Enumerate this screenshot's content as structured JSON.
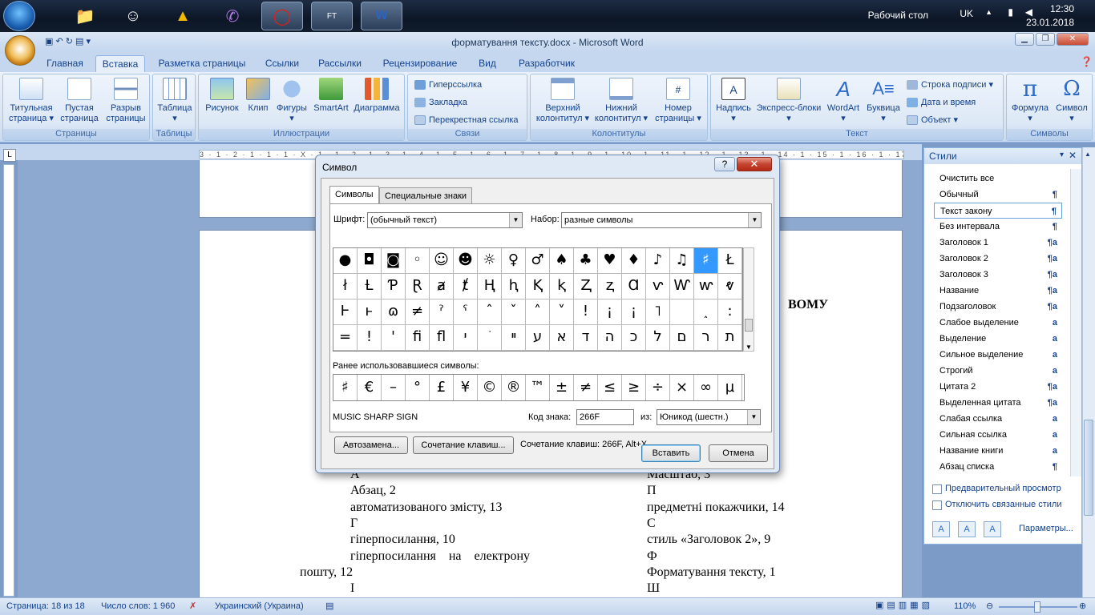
{
  "taskbar": {
    "clock_time": "12:30",
    "clock_date": "23.01.2018",
    "desktop_label": "Рабочий стол",
    "lang": "UK",
    "app_badge": "FT"
  },
  "window": {
    "title": "форматування тексту.docx - Microsoft Word"
  },
  "tabs": [
    "Главная",
    "Вставка",
    "Разметка страницы",
    "Ссылки",
    "Рассылки",
    "Рецензирование",
    "Вид",
    "Разработчик"
  ],
  "ribbon": {
    "pages": {
      "caption": "Страницы",
      "btn1": "Титульная",
      "btn1b": "страница",
      "btn2": "Пустая",
      "btn2b": "страница",
      "btn3": "Разрыв",
      "btn3b": "страницы"
    },
    "tables": {
      "caption": "Таблицы",
      "btn": "Таблица"
    },
    "illustrations": {
      "caption": "Иллюстрации",
      "btn1": "Рисунок",
      "btn2": "Клип",
      "btn3": "Фигуры",
      "btn4": "SmartArt",
      "btn5": "Диаграмма"
    },
    "links": {
      "caption": "Связи",
      "item1": "Гиперссылка",
      "item2": "Закладка",
      "item3": "Перекрестная ссылка"
    },
    "headers": {
      "caption": "Колонтитулы",
      "btn1": "Верхний",
      "btn1b": "колонтитул",
      "btn2": "Нижний",
      "btn2b": "колонтитул",
      "btn3": "Номер",
      "btn3b": "страницы"
    },
    "text": {
      "caption": "Текст",
      "btn1": "Надпись",
      "btn2": "Экспресс-блоки",
      "btn3": "WordArt",
      "btn4": "Буквица",
      "item1": "Строка подписи",
      "item2": "Дата и время",
      "item3": "Объект"
    },
    "symbols": {
      "caption": "Символы",
      "btn1": "Формула",
      "btn2": "Символ"
    }
  },
  "ruler_text": "3 · 1 · 2 · 1 · 1 · 1 · X · 1 · 1 · 2 · 1 · 3 · 1 · 4 · 1 · 5 · 1 · 6 · 1 · 7 · 1 · 8 · 1 · 9 · 1 · 10 · 1 · 11 · 1 · 12 · 1 · 13 · 1 · 14 · 1 · 15 · 1 · 16 · 1 · 17 ·",
  "document": {
    "heading_fragment": "ВОМУ",
    "left": [
      "А",
      "Абзац, 2",
      "автоматизованого змісту, 13",
      "Г",
      "гіперпосилання, 10",
      "гіперпосилання    на    електрону",
      "пошту, 12",
      "І"
    ],
    "right": [
      "Масштаб, 3",
      "П",
      "предметні покажчики, 14",
      "С",
      "стиль «Заголовок 2», 9",
      "Ф",
      "Форматування тексту, 1",
      "Ш"
    ]
  },
  "styles_pane": {
    "title": "Стили",
    "items": [
      {
        "name": "Очистить все",
        "mark": ""
      },
      {
        "name": "Обычный",
        "mark": "¶"
      },
      {
        "name": "Текст закону",
        "mark": "¶"
      },
      {
        "name": "Без интервала",
        "mark": "¶"
      },
      {
        "name": "Заголовок 1",
        "mark": "¶a"
      },
      {
        "name": "Заголовок 2",
        "mark": "¶a"
      },
      {
        "name": "Заголовок 3",
        "mark": "¶a"
      },
      {
        "name": "Название",
        "mark": "¶a"
      },
      {
        "name": "Подзаголовок",
        "mark": "¶a"
      },
      {
        "name": "Слабое выделение",
        "mark": "a"
      },
      {
        "name": "Выделение",
        "mark": "a"
      },
      {
        "name": "Сильное выделение",
        "mark": "a"
      },
      {
        "name": "Строгий",
        "mark": "a"
      },
      {
        "name": "Цитата 2",
        "mark": "¶a"
      },
      {
        "name": "Выделенная цитата",
        "mark": "¶a"
      },
      {
        "name": "Слабая ссылка",
        "mark": "a"
      },
      {
        "name": "Сильная ссылка",
        "mark": "a"
      },
      {
        "name": "Название книги",
        "mark": "a"
      },
      {
        "name": "Абзац списка",
        "mark": "¶"
      }
    ],
    "selected_index": 2,
    "preview_label": "Предварительный просмотр",
    "disable_linked_label": "Отключить связанные стили",
    "params_label": "Параметры..."
  },
  "status": {
    "page": "Страница: 18 из 18",
    "words": "Число слов: 1 960",
    "lang": "Украинский (Украина)",
    "zoom": "110%"
  },
  "dialog": {
    "title": "Символ",
    "help": "?",
    "close": "✕",
    "tab1": "Символы",
    "tab2": "Специальные знаки",
    "font_label": "Шрифт:",
    "font_value": "(обычный текст)",
    "subset_label": "Набор:",
    "subset_value": "разные символы",
    "grid": [
      [
        "●",
        "◘",
        "◙",
        "◦",
        "☺",
        "☻",
        "☼",
        "♀",
        "♂",
        "♠",
        "♣",
        "♥",
        "♦",
        "♪",
        "♫",
        "♯",
        "Ł"
      ],
      [
        "ł",
        "Ƚ",
        "Ƥ",
        "Ɽ",
        "ⱥ",
        "ⱦ",
        "Ⱨ",
        "ⱨ",
        "Ⱪ",
        "ⱪ",
        "Ⱬ",
        "ⱬ",
        "Ɑ",
        "ⱱ",
        "Ⱳ",
        "ⱳ",
        "ⱴ"
      ],
      [
        "Ⱶ",
        "ⱶ",
        "ɷ",
        "≠",
        "ˀ",
        "ˁ",
        "ˆ",
        "ˇ",
        "˄",
        "˅",
        "!",
        "¡",
        "¡",
        "˥",
        "",
        "˰",
        ":"
      ],
      [
        "=",
        "!",
        "'",
        "ﬁ",
        "ﬂ",
        "י",
        "ֹ",
        "ײ",
        "ע",
        "א",
        "ד",
        "ה",
        "כ",
        "ל",
        "ם",
        "ר",
        "ת"
      ]
    ],
    "selected_cell": [
      0,
      15
    ],
    "recent_label": "Ранее использовавшиеся символы:",
    "recent": [
      "♯",
      "€",
      "–",
      "°",
      "£",
      "¥",
      "©",
      "®",
      "™",
      "±",
      "≠",
      "≤",
      "≥",
      "÷",
      "×",
      "∞",
      "µ"
    ],
    "char_name": "MUSIC SHARP SIGN",
    "code_label": "Код знака:",
    "code_value": "266F",
    "from_label": "из:",
    "from_value": "Юникод (шестн.)",
    "autocorrect_btn": "Автозамена...",
    "shortcut_btn": "Сочетание клавиш...",
    "shortcut_text": "Сочетание клавиш: 266F, Alt+X",
    "insert_btn": "Вставить",
    "cancel_btn": "Отмена"
  }
}
